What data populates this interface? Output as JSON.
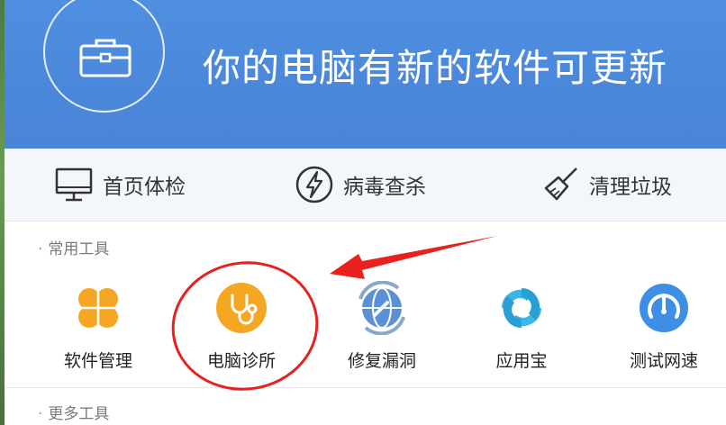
{
  "header": {
    "title": "你的电脑有新的软件可更新",
    "icon": "toolbox-icon"
  },
  "tabs": [
    {
      "label": "首页体检",
      "icon": "monitor-icon"
    },
    {
      "label": "病毒查杀",
      "icon": "lightning-icon"
    },
    {
      "label": "清理垃圾",
      "icon": "broom-icon"
    }
  ],
  "sections": {
    "common": {
      "bullet": "·",
      "title": "常用工具"
    },
    "more": {
      "bullet": "·",
      "title": "更多工具"
    }
  },
  "tools": [
    {
      "label": "软件管理",
      "icon": "clover-icon",
      "color": "#f5a623"
    },
    {
      "label": "电脑诊所",
      "icon": "stethoscope-icon",
      "color": "#f5a623"
    },
    {
      "label": "修复漏洞",
      "icon": "repair-globe-icon",
      "color": "#5b8fd6"
    },
    {
      "label": "应用宝",
      "icon": "app-store-icon",
      "color": "#3ab6e8"
    },
    {
      "label": "测试网速",
      "icon": "speed-gauge-icon",
      "color": "#3d8fe6"
    }
  ],
  "colors": {
    "header_blue": "#4a88dc",
    "annotation_red": "#e8211f",
    "tab_bg": "#f3f6fa"
  }
}
